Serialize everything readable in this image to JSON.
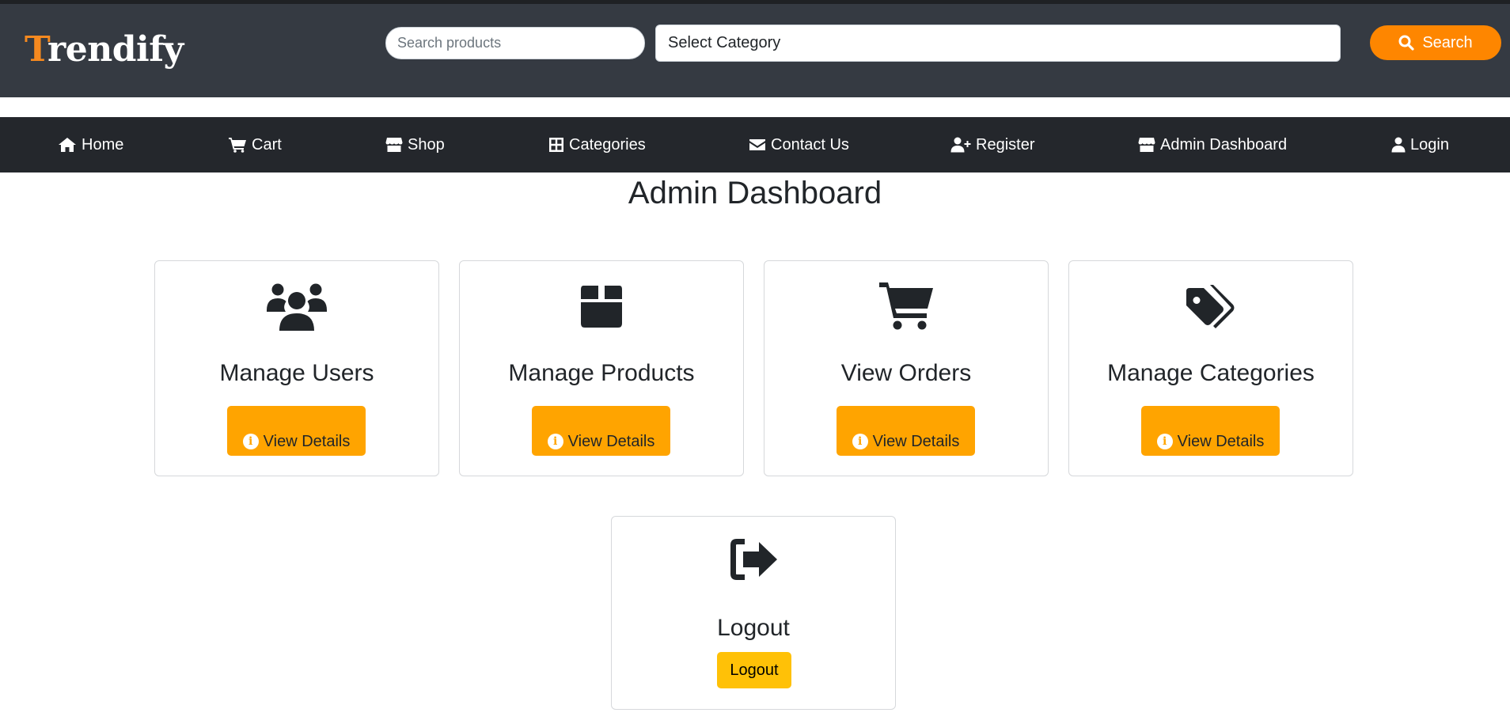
{
  "brand": {
    "first_letter": "T",
    "rest": "rendify",
    "accent_color": "#f6891f"
  },
  "search": {
    "placeholder": "Search products",
    "category_value": "Select Category",
    "button_label": "Search"
  },
  "nav": {
    "items": [
      {
        "label": "Home",
        "icon": "home-icon"
      },
      {
        "label": "Cart",
        "icon": "cart-icon"
      },
      {
        "label": "Shop",
        "icon": "shop-icon"
      },
      {
        "label": "Categories",
        "icon": "grid-icon"
      },
      {
        "label": "Contact Us",
        "icon": "envelope-icon"
      },
      {
        "label": "Register",
        "icon": "user-plus-icon"
      },
      {
        "label": "Admin Dashboard",
        "icon": "shop-icon"
      },
      {
        "label": "Login",
        "icon": "user-icon"
      }
    ]
  },
  "page": {
    "title": "Admin Dashboard"
  },
  "cards": [
    {
      "title": "Manage Users",
      "icon": "users-icon",
      "button_label": "View Details"
    },
    {
      "title": "Manage Products",
      "icon": "box-icon",
      "button_label": "View Details"
    },
    {
      "title": "View Orders",
      "icon": "cart-icon",
      "button_label": "View Details"
    },
    {
      "title": "Manage Categories",
      "icon": "tags-icon",
      "button_label": "View Details"
    }
  ],
  "logout_card": {
    "title": "Logout",
    "icon": "logout-icon",
    "button_label": "Logout"
  },
  "colors": {
    "header_bg": "#353a42",
    "nav_bg": "#24272c",
    "search_button": "#fe8600",
    "details_button": "#ffa400",
    "logout_button": "#ffc107"
  }
}
